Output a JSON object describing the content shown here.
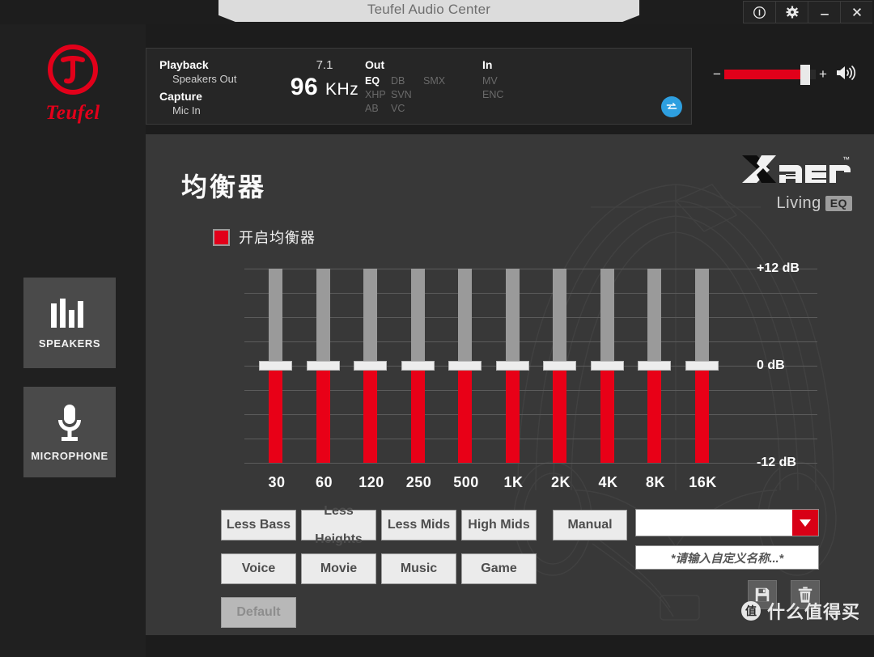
{
  "window": {
    "title": "Teufel Audio Center",
    "controls": [
      {
        "name": "info-icon",
        "label": "ⓘ"
      },
      {
        "name": "gear-icon",
        "label": "⚙"
      },
      {
        "name": "minimize-icon",
        "label": "–"
      },
      {
        "name": "close-icon",
        "label": "✕"
      }
    ]
  },
  "sidebar": {
    "brand": "Teufel",
    "items": [
      {
        "id": "speakers",
        "label": "SPEAKERS",
        "icon": "equalizer-bars-icon"
      },
      {
        "id": "microphone",
        "label": "MICROPHONE",
        "icon": "microphone-icon"
      }
    ]
  },
  "status": {
    "playback_label": "Playback",
    "playback_value": "Speakers Out",
    "capture_label": "Capture",
    "capture_value": "Mic In",
    "channels": "7.1",
    "rate_number": "96",
    "rate_unit": "KHz",
    "out_label": "Out",
    "out_tags": [
      {
        "text": "EQ",
        "active": true
      },
      {
        "text": "DB",
        "active": false
      },
      {
        "text": "SMX",
        "active": false
      },
      {
        "text": "XHP",
        "active": false
      },
      {
        "text": "SVN",
        "active": false
      },
      {
        "text": "AB",
        "active": false
      },
      {
        "text": "VC",
        "active": false
      }
    ],
    "in_label": "In",
    "in_tags": [
      {
        "text": "MV",
        "active": false
      },
      {
        "text": "ENC",
        "active": false
      }
    ],
    "swap_icon": "swap-arrows-icon"
  },
  "volume": {
    "minus": "−",
    "plus": "+",
    "level_percent": 88,
    "speaker_icon": "speaker-volume-icon"
  },
  "eq_panel": {
    "title": "均衡器",
    "enable_label": "开启均衡器",
    "enabled": true,
    "logo_main": "Xear",
    "logo_tm": "™",
    "logo_sub": "Living",
    "logo_badge": "EQ"
  },
  "chart_data": {
    "type": "bar",
    "title": "均衡器",
    "categories": [
      "30",
      "60",
      "120",
      "250",
      "500",
      "1K",
      "2K",
      "4K",
      "8K",
      "16K"
    ],
    "values": [
      0,
      0,
      0,
      0,
      0,
      0,
      0,
      0,
      0,
      0
    ],
    "xlabel": "",
    "ylabel": "dB",
    "ylim": [
      -12,
      12
    ],
    "grid": true,
    "gridline_count": 9,
    "axis_labels": [
      {
        "value": 12,
        "text": "+12 dB"
      },
      {
        "value": 0,
        "text": "0    dB"
      },
      {
        "value": -12,
        "text": "-12 dB"
      }
    ]
  },
  "presets": {
    "row1": [
      {
        "id": "less-bass",
        "label": "Less Bass",
        "disabled": false
      },
      {
        "id": "less-heights",
        "label": "Less\nHeights",
        "disabled": false
      },
      {
        "id": "less-mids",
        "label": "Less Mids",
        "disabled": false
      },
      {
        "id": "high-mids",
        "label": "High Mids",
        "disabled": false
      }
    ],
    "row2": [
      {
        "id": "voice",
        "label": "Voice",
        "disabled": false
      },
      {
        "id": "movie",
        "label": "Movie",
        "disabled": false
      },
      {
        "id": "music",
        "label": "Music",
        "disabled": false
      },
      {
        "id": "game",
        "label": "Game",
        "disabled": false
      }
    ],
    "row3": [
      {
        "id": "default",
        "label": "Default",
        "disabled": true
      }
    ],
    "manual_label": "Manual"
  },
  "custom": {
    "dropdown_value": "",
    "dropdown_arrow_icon": "chevron-down-icon",
    "name_placeholder": "*请输入自定义名称...*",
    "save_icon": "floppy-save-icon",
    "delete_icon": "trash-delete-icon"
  },
  "watermark": {
    "badge": "值",
    "text": "什么值得买"
  },
  "colors": {
    "accent_red": "#e2001a",
    "slider_red": "#e80017",
    "panel_bg": "#383838",
    "sidebar_bg": "#202020",
    "swap_blue": "#2e9fe0"
  }
}
